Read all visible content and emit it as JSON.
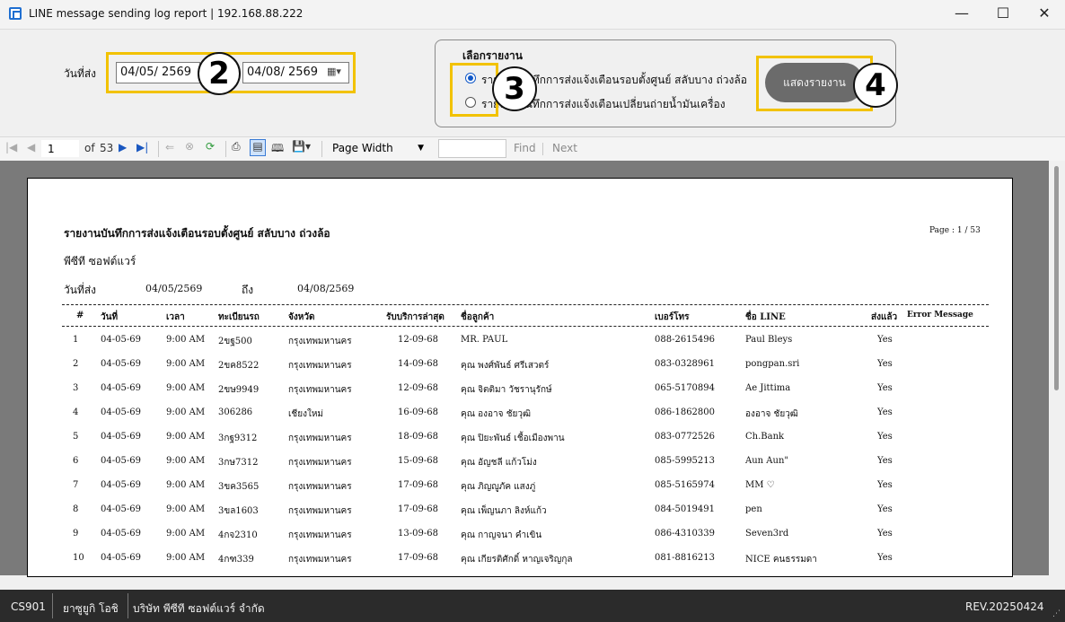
{
  "window": {
    "title": "LINE message sending log report | 192.168.88.222",
    "minimize": "—",
    "maximize": "☐",
    "close": "✕"
  },
  "filter": {
    "date_label": "วันที่ส่ง",
    "date_from": "04/05/  2569",
    "date_to": "04/08/  2569",
    "calendar_icon": "calendar-icon"
  },
  "report_select": {
    "group_title": "เลือกรายงาน",
    "option1": "รายงานบันทึกการส่งแจ้งเตือนรอบตั้งศูนย์ สลับบาง ถ่วงล้อ",
    "option2": "รายงานบันทึกการส่งแจ้งเตือนเปลี่ยนถ่ายน้ำมันเครื่อง",
    "selected": 1,
    "show_button": "แสดงรายงาน"
  },
  "annotations": [
    "2",
    "3",
    "4"
  ],
  "toolbar": {
    "page": "1",
    "of_label": "of",
    "total_pages": "53",
    "zoom": "Page Width",
    "find": "Find",
    "next": "Next"
  },
  "report": {
    "title": "รายงานบันทึกการส่งแจ้งเตือนรอบตั้งศูนย์ สลับบาง ถ่วงล้อ",
    "company": "พีซีที ซอฟต์แวร์",
    "page_info": "Page :  1  /  53",
    "date_label": "วันที่ส่ง",
    "date_from": "04/05/2569",
    "to_label": "ถึง",
    "date_to": "04/08/2569",
    "columns": [
      "#",
      "วันที่",
      "เวลา",
      "ทะเบียนรถ",
      "จังหวัด",
      "รับบริการล่าสุด",
      "ชื่อลูกค้า",
      "เบอร์โทร",
      "ชื่อ LINE",
      "ส่งแล้ว",
      "Error Message"
    ],
    "rows": [
      [
        "1",
        "04-05-69",
        "9:00 AM",
        "2ขฐ500",
        "กรุงเทพมหานคร",
        "12-09-68",
        "MR. PAUL",
        "088-2615496",
        "Paul Bleys",
        "Yes",
        ""
      ],
      [
        "2",
        "04-05-69",
        "9:00 AM",
        "2ขค8522",
        "กรุงเทพมหานคร",
        "14-09-68",
        "คุณ พงศ์พันธ์ ศรีเสวตร์",
        "083-0328961",
        "pongpan.sri",
        "Yes",
        ""
      ],
      [
        "3",
        "04-05-69",
        "9:00 AM",
        "2ขษ9949",
        "กรุงเทพมหานคร",
        "12-09-68",
        "คุณ จิตติมา วัชรานุรักษ์",
        "065-5170894",
        "Ae Jittima",
        "Yes",
        ""
      ],
      [
        "4",
        "04-05-69",
        "9:00 AM",
        "306286",
        "เชียงใหม่",
        "16-09-68",
        "คุณ องอาจ ชัยวุฒิ",
        "086-1862800",
        "องอาจ ชัยวุฒิ",
        "Yes",
        ""
      ],
      [
        "5",
        "04-05-69",
        "9:00 AM",
        "3กฐ9312",
        "กรุงเทพมหานคร",
        "18-09-68",
        "คุณ ปิยะพันธ์ เชื้อเมืองพาน",
        "083-0772526",
        "Ch.Bank",
        "Yes",
        ""
      ],
      [
        "6",
        "04-05-69",
        "9:00 AM",
        "3กษ7312",
        "กรุงเทพมหานคร",
        "15-09-68",
        "คุณ อัญชลี แก้วโม่ง",
        "085-5995213",
        "Aun Aun\"",
        "Yes",
        ""
      ],
      [
        "7",
        "04-05-69",
        "9:00 AM",
        "3ขค3565",
        "กรุงเทพมหานคร",
        "17-09-68",
        "คุณ ภิญญูภัค แสงภู่",
        "085-5165974",
        "MM ♡",
        "Yes",
        ""
      ],
      [
        "8",
        "04-05-69",
        "9:00 AM",
        "3ขล1603",
        "กรุงเทพมหานคร",
        "17-09-68",
        "คุณ เพ็ญนภา ลิงห์แก้ว",
        "084-5019491",
        "pen",
        "Yes",
        ""
      ],
      [
        "9",
        "04-05-69",
        "9:00 AM",
        "4กจ2310",
        "กรุงเทพมหานคร",
        "13-09-68",
        "คุณ กาญจนา คำเขิน",
        "086-4310339",
        "Seven3rd",
        "Yes",
        ""
      ],
      [
        "10",
        "04-05-69",
        "9:00 AM",
        "4กฑ339",
        "กรุงเทพมหานคร",
        "17-09-68",
        "คุณ เกียรติศักดิ์ หาญเจริญกุล",
        "081-8816213",
        "NICE คนธรรมดา",
        "Yes",
        ""
      ]
    ]
  },
  "status": {
    "code": "CS901",
    "user": "ยาซูยูกิ  โอชิ",
    "company": "บริษัท พีซีที ซอฟต์แวร์ จำกัด",
    "revision": "REV.20250424"
  }
}
